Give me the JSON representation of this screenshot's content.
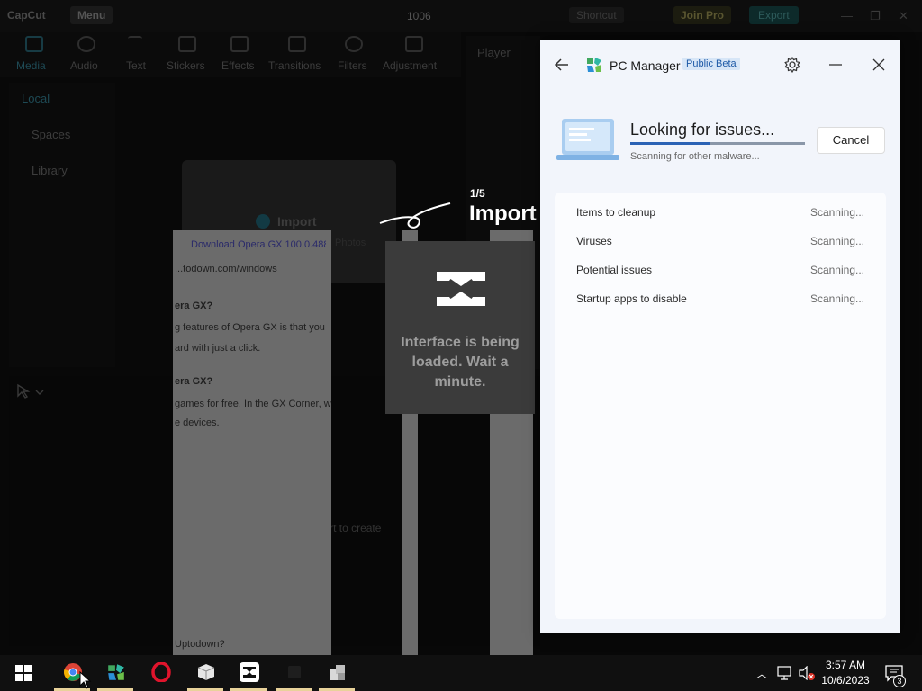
{
  "capcut": {
    "logo": "CapCut",
    "menu": "Menu",
    "project_title": "1006",
    "shortcut": "Shortcut",
    "join_pro": "Join Pro",
    "export": "Export",
    "toolbar": [
      {
        "label": "Media",
        "active": true
      },
      {
        "label": "Audio"
      },
      {
        "label": "Text"
      },
      {
        "label": "Stickers"
      },
      {
        "label": "Effects"
      },
      {
        "label": "Transitions"
      },
      {
        "label": "Filters"
      },
      {
        "label": "Adjustment"
      }
    ],
    "sidebar": [
      "Local",
      "Spaces",
      "Library"
    ],
    "import_label": "Import",
    "player_label": "Player",
    "drag_hint": "Drag material here and start to create"
  },
  "tutorial": {
    "step": "1/5",
    "title": "Import"
  },
  "loading": {
    "message": "Interface is being loaded. Wait a minute."
  },
  "bleed": {
    "tab_text": "Download Opera GX 100.0.488...",
    "photos": "Photos",
    "url": "...todown.com/windows",
    "q1": "era GX?",
    "p1": "g features of Opera GX is that you",
    "p2": "ard with just a click.",
    "q2": "era GX?",
    "p3": "games for free. In the GX Corner, wh",
    "p4": "e devices.",
    "footer": "Uptodown?"
  },
  "pc_manager": {
    "title": "PC Manager",
    "badge": "Public Beta",
    "heading": "Looking for issues...",
    "subtext": "Scanning for other malware...",
    "cancel": "Cancel",
    "progress": 0.46,
    "items": [
      {
        "label": "Items to cleanup",
        "status": "Scanning..."
      },
      {
        "label": "Viruses",
        "status": "Scanning..."
      },
      {
        "label": "Potential issues",
        "status": "Scanning..."
      },
      {
        "label": "Startup apps to disable",
        "status": "Scanning..."
      }
    ]
  },
  "taskbar": {
    "apps": [
      "chrome-icon",
      "pc-manager-icon",
      "opera-icon",
      "package-icon",
      "capcut-icon",
      "blank-app-icon",
      "installer-icon"
    ],
    "time": "3:57 AM",
    "date": "10/6/2023",
    "notifications": "3"
  },
  "colors": {
    "accent": "#2b63b5",
    "badge_bg": "#d7e6f7",
    "taskbar_bg": "#101010",
    "highlight": "#e8d29a"
  }
}
